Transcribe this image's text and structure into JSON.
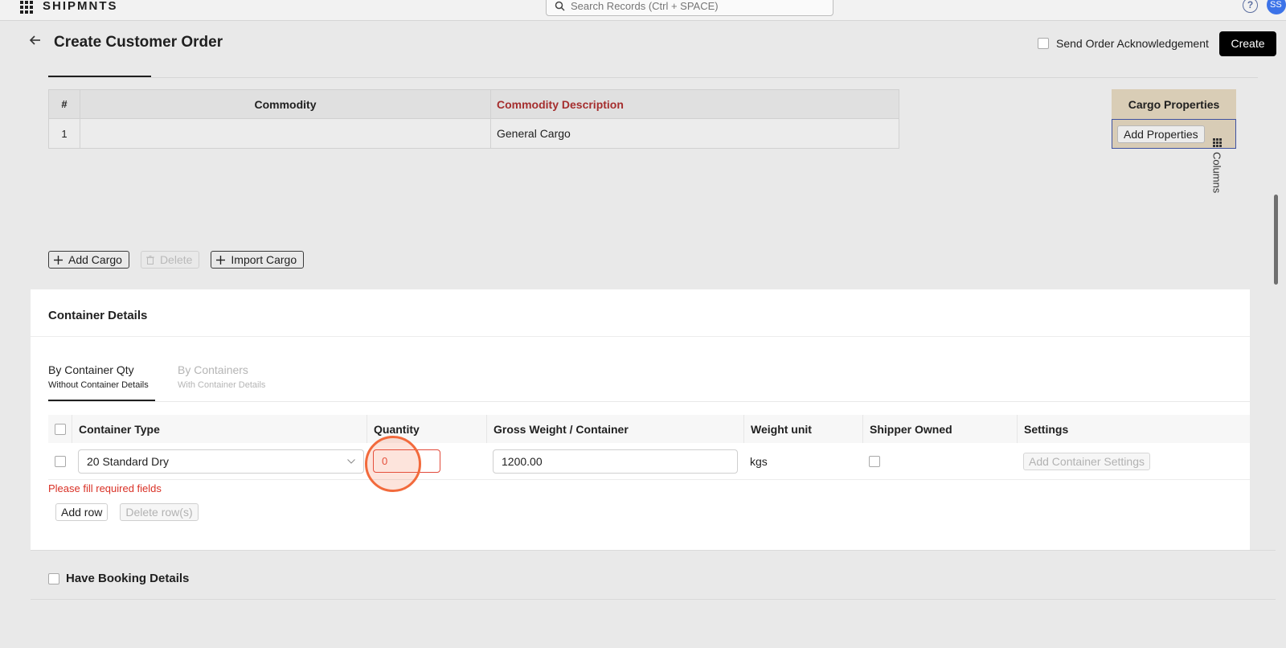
{
  "app": {
    "brand": "SHIPMNTS",
    "avatar_initials": "SS"
  },
  "search": {
    "placeholder": "Search Records (Ctrl + SPACE)"
  },
  "header": {
    "title": "Create Customer Order",
    "ack_label": "Send Order Acknowledgement",
    "ack_checked": false,
    "create_label": "Create"
  },
  "cargo": {
    "columns": [
      "#",
      "Commodity",
      "Commodity Description"
    ],
    "rows": [
      {
        "num": "1",
        "commodity": "",
        "description": "General Cargo"
      }
    ],
    "properties_header": "Cargo Properties",
    "add_properties_label": "Add Properties",
    "columns_toggle_label": "Columns",
    "actions": {
      "add_label": "Add Cargo",
      "delete_label": "Delete",
      "import_label": "Import Cargo"
    }
  },
  "container": {
    "title": "Container Details",
    "tabs": [
      {
        "label": "By Container Qty",
        "sublabel": "Without Container Details",
        "active": true
      },
      {
        "label": "By Containers",
        "sublabel": "With Container Details",
        "active": false
      }
    ],
    "columns": [
      "Container Type",
      "Quantity",
      "Gross Weight / Container",
      "Weight unit",
      "Shipper Owned",
      "Settings"
    ],
    "rows": [
      {
        "container_type": "20 Standard Dry",
        "quantity": "0",
        "gross_weight": "1200.00",
        "weight_unit": "kgs",
        "shipper_owned": false,
        "settings_label": "Add Container Settings"
      }
    ],
    "error_text": "Please fill required fields",
    "add_row_label": "Add row",
    "delete_rows_label": "Delete row(s)"
  },
  "booking": {
    "label": "Have Booking Details",
    "checked": false
  },
  "colors": {
    "accent": "#000000",
    "error": "#d93025",
    "click_marker": "#f26a3c",
    "required_header": "#a52e2e"
  },
  "icons": [
    "apps-grid-icon",
    "search-icon",
    "help-icon",
    "back-arrow-icon",
    "plus-icon",
    "trash-icon",
    "chevron-down-icon",
    "columns-grid-icon"
  ]
}
